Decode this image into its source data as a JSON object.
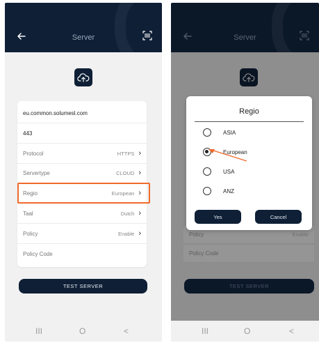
{
  "screen_before": {
    "header": {
      "title": "Server"
    },
    "server_address": "eu.common.solumesl.com",
    "port": "443",
    "settings": [
      {
        "label": "Protocol",
        "value": "HTTPS"
      },
      {
        "label": "Servertype",
        "value": "CLOUD"
      },
      {
        "label": "Regio",
        "value": "European"
      },
      {
        "label": "Taal",
        "value": "Dutch"
      },
      {
        "label": "Policy",
        "value": "Enable"
      }
    ],
    "policy_code_label": "Policy Code",
    "test_button": "TEST SERVER",
    "nav": {
      "recents": "III",
      "home": "O",
      "back": "<"
    }
  },
  "screen_after": {
    "header": {
      "title": "Server"
    },
    "background_rows": {
      "policy": "Policy",
      "policy_value": "Enable",
      "policy_code": "Policy Code"
    },
    "test_button": "TEST SERVER",
    "dialog": {
      "title": "Regio",
      "options": [
        {
          "label": "ASIA",
          "selected": false
        },
        {
          "label": "European",
          "selected": true
        },
        {
          "label": "USA",
          "selected": false
        },
        {
          "label": "ANZ",
          "selected": false
        }
      ],
      "yes": "Yes",
      "cancel": "Cancel"
    },
    "nav": {
      "recents": "III",
      "home": "O",
      "back": "<"
    }
  },
  "colors": {
    "navy": "#0e1f36",
    "highlight": "#f06a2b",
    "chevron": "#333333"
  },
  "icons": [
    "back-arrow-icon",
    "scan-icon",
    "cloud-upload-icon",
    "chevron-right-icon",
    "radio-icon",
    "arrow-pointer-icon"
  ]
}
